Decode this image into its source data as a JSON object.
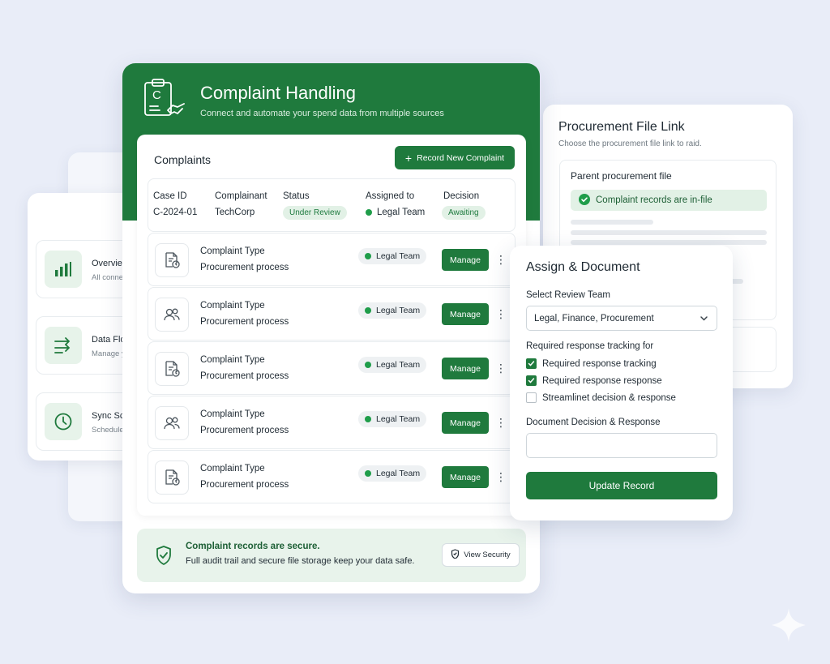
{
  "sidebar": {
    "items": [
      {
        "title": "Overview",
        "subtitle": "All connect",
        "icon": "bar-chart-icon"
      },
      {
        "title": "Data Flow",
        "subtitle": "Manage yo",
        "icon": "transfer-arrows-icon"
      },
      {
        "title": "Sync Sche",
        "subtitle": "Schedule a",
        "icon": "clock-icon"
      }
    ]
  },
  "header": {
    "logo_letter": "C",
    "title": "Complaint Handling",
    "subtitle": "Connect and automate your spend data from multiple sources"
  },
  "complaints": {
    "title": "Complaints",
    "record_button": "Record New Complaint",
    "summary": {
      "headers": {
        "case_id": "Case ID",
        "complainant": "Complainant",
        "status": "Status",
        "assigned_to": "Assigned to",
        "decision": "Decision"
      },
      "values": {
        "case_id": "C-2024-01",
        "complainant": "TechCorp",
        "status": "Under Review",
        "assigned_to": "Legal Team",
        "decision": "Awaiting"
      }
    },
    "rows": [
      {
        "title": "Complaint Type",
        "subtitle": "Procurement process",
        "team": "Legal Team",
        "action": "Manage",
        "icon": "document-clock-icon"
      },
      {
        "title": "Complaint Type",
        "subtitle": "Procurement process",
        "team": "Legal Team",
        "action": "Manage",
        "icon": "users-icon"
      },
      {
        "title": "Complaint Type",
        "subtitle": "Procurement process",
        "team": "Legal Team",
        "action": "Manage",
        "icon": "document-clock-icon"
      },
      {
        "title": "Complaint Type",
        "subtitle": "Procurement process",
        "team": "Legal Team",
        "action": "Manage",
        "icon": "users-icon"
      },
      {
        "title": "Complaint Type",
        "subtitle": "Procurement process",
        "team": "Legal Team",
        "action": "Manage",
        "icon": "document-clock-icon"
      }
    ]
  },
  "security": {
    "title": "Complaint records are secure.",
    "description": "Full audit trail and secure file storage keep your data safe.",
    "button": "View Security"
  },
  "procurement": {
    "title": "Procurement File Link",
    "subtitle": "Choose the procurement file link to raid.",
    "parent_label": "Parent procurement file",
    "banner": "Complaint records are in-file"
  },
  "assign": {
    "title": "Assign & Document",
    "team_label": "Select Review Team",
    "team_value": "Legal, Finance, Procurement",
    "tracking_label": "Required response tracking for",
    "checkboxes": [
      {
        "label": "Required response tracking",
        "checked": true
      },
      {
        "label": "Required response response",
        "checked": true
      },
      {
        "label": "Streamlinet decision & response",
        "checked": false
      }
    ],
    "doc_label": "Document Decision & Response",
    "doc_value": "",
    "update_button": "Update Record"
  },
  "colors": {
    "brand_green": "#1f7a3d",
    "light_green": "#e2f1e6",
    "background": "#e9edf8"
  }
}
